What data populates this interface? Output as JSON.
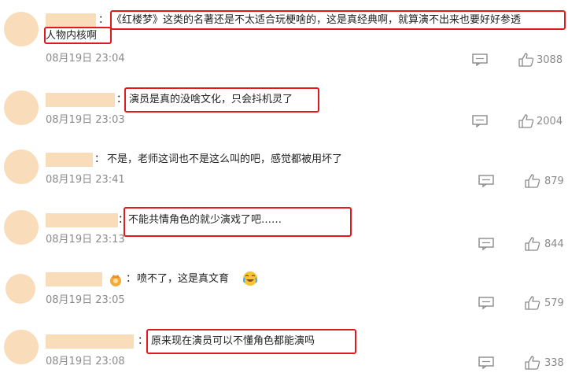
{
  "comments": [
    {
      "text_line1": "《红楼梦》这类的名著还是不太适合玩梗啥的，这是真经典啊，就算演不出来也要好好参透",
      "text_line2": "人物内核啊",
      "time": "08月19日 23:04",
      "likes": "3088"
    },
    {
      "text": "演员是真的没啥文化，只会抖机灵了",
      "time": "08月19日 23:03",
      "likes": "2004"
    },
    {
      "text": "不是，老师这词也不是这么叫的吧，感觉都被用坏了",
      "time": "08月19日 23:41",
      "likes": "879"
    },
    {
      "text": "不能共情角色的就少演戏了吧……",
      "time": "08月19日 23:13",
      "likes": "844"
    },
    {
      "text": "喷不了，这是真文育",
      "time": "08月19日 23:05",
      "likes": "579"
    },
    {
      "text": "原来现在演员可以不懂角色都能演吗",
      "time": "08月19日 23:08",
      "likes": "338"
    }
  ],
  "colon": "：",
  "colors": {
    "highlight": "#e0191d",
    "redacted": "#f9dcb9",
    "meta_text": "#8a8a8a"
  },
  "icons": {
    "comment": "comment-bubble-icon",
    "like": "thumbs-up-icon",
    "badge": "fan-badge-icon",
    "emoji": "laugh-cry-emoji-icon"
  }
}
